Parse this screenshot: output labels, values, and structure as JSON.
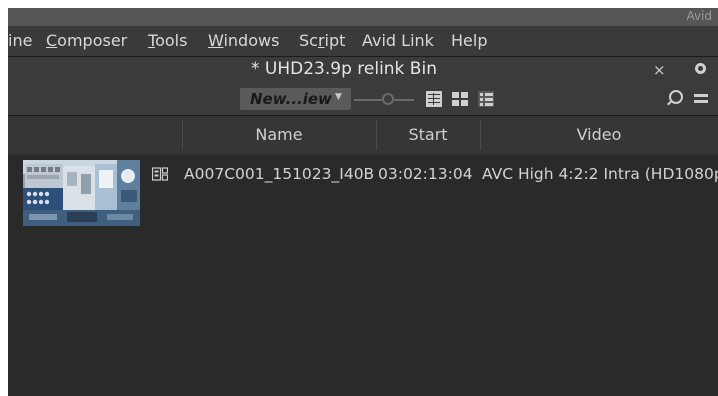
{
  "app": {
    "brand": "Avid"
  },
  "menu": {
    "items": [
      "ine",
      "Composer",
      "Tools",
      "Windows",
      "Script",
      "Avid Link",
      "Help"
    ]
  },
  "bin": {
    "title": "* UHD23.9p relink Bin",
    "close_label": "×",
    "view_select": {
      "label": "New...iew"
    },
    "columns": [
      "Name",
      "Start",
      "Video"
    ],
    "rows": [
      {
        "name": "A007C001_151023_I40B",
        "start": "03:02:13:04",
        "video": "AVC High 4:2:2 Intra (HD1080p"
      }
    ]
  },
  "icons": {
    "settings": "settings-circle-icon",
    "find": "search-icon",
    "bin_menu": "hamburger-menu-icon",
    "frame_view": "frame-view-icon",
    "script_view": "script-view-icon",
    "text_view": "text-view-icon",
    "clip": "master-clip-icon"
  }
}
